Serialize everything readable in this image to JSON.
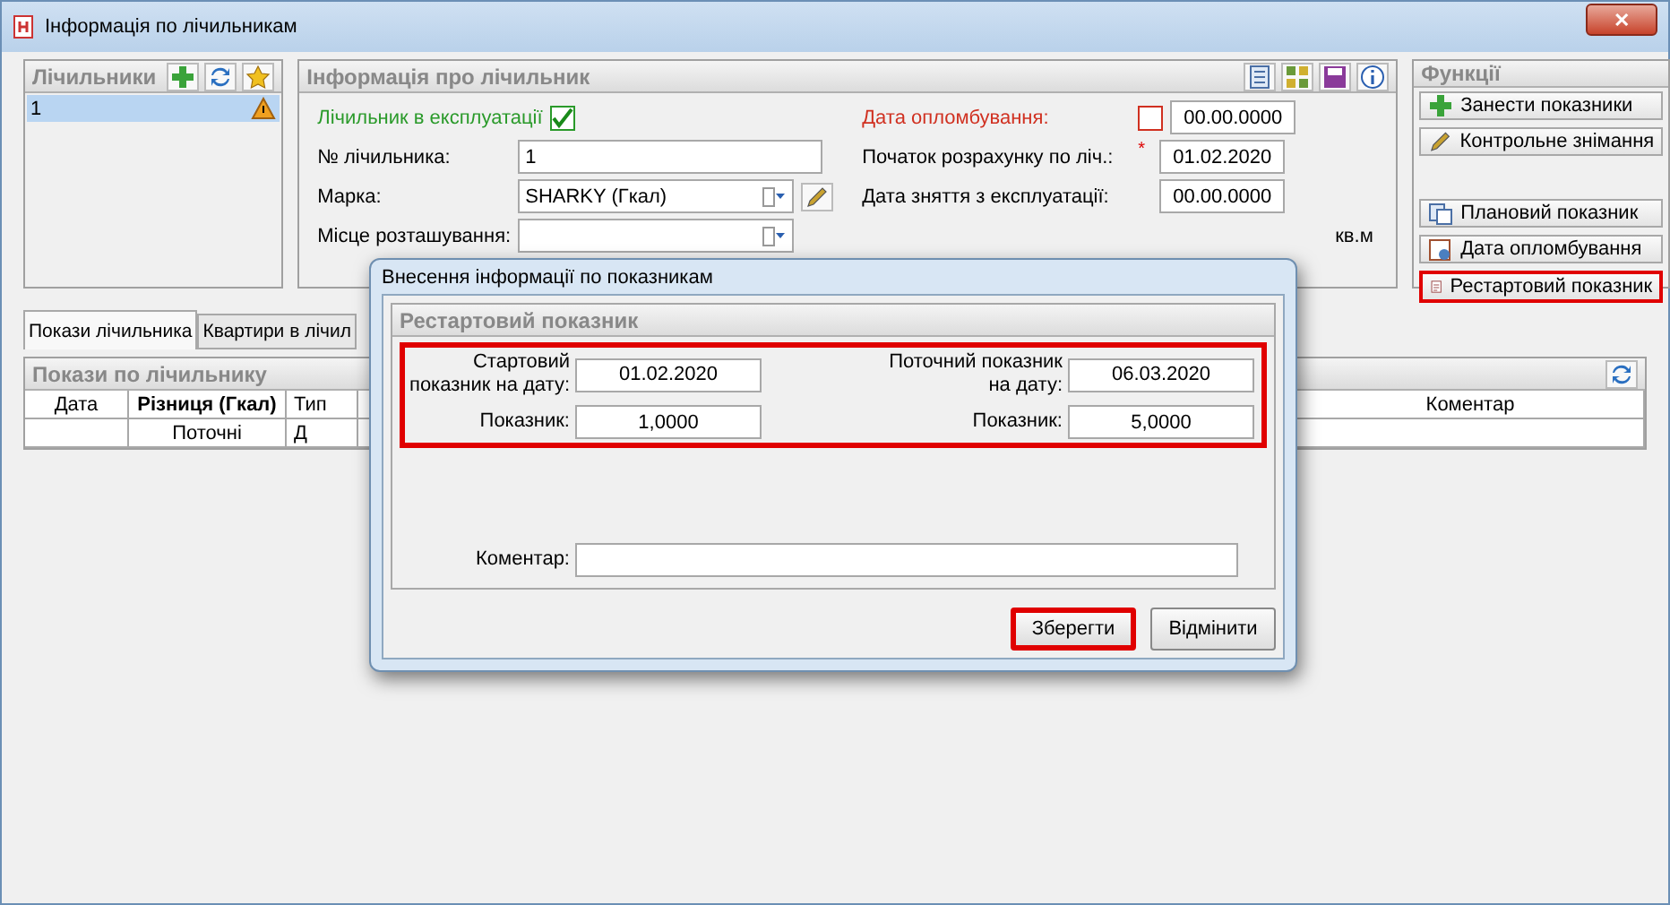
{
  "window": {
    "title": "Інформація по лічильникам",
    "close": "✕"
  },
  "meters": {
    "title": "Лічильники",
    "rows": [
      {
        "number": "1",
        "warning": true,
        "selected": true
      }
    ]
  },
  "info": {
    "title": "Інформація про лічильник",
    "in_service": {
      "label": "Лічильник в експлуатації",
      "checked": true
    },
    "left_fields": [
      {
        "kind": "text",
        "label": "№ лічильника:",
        "value": "1"
      },
      {
        "kind": "select",
        "label": "Марка:",
        "value": "SHARKY (Гкал)",
        "editable": true
      },
      {
        "kind": "select",
        "label": "Місце розташування:",
        "editable": false
      }
    ],
    "right_fields": [
      {
        "label": "Дата опломбування:",
        "value": "00.00.0000",
        "warn": true,
        "checkbox": {
          "checked": false
        }
      },
      {
        "label": "Початок розрахунку по ліч.:",
        "value": "01.02.2020",
        "warn": false,
        "required": "*"
      },
      {
        "label": "Дата зняття з експлуатації:",
        "value": "00.00.0000",
        "warn": false
      }
    ],
    "area_unit": "кв.м"
  },
  "functions": {
    "title": "Функції",
    "buttons": [
      {
        "label": "Занести показники",
        "highlighted": false
      },
      {
        "label": "Контрольне знімання",
        "highlighted": false
      },
      {
        "label": "Плановий показник",
        "highlighted": false
      },
      {
        "label": "Дата опломбування",
        "highlighted": false
      },
      {
        "label": "Рестартовий показник",
        "highlighted": true
      }
    ]
  },
  "tabs": [
    {
      "label": "Покази лічильника",
      "selected": true
    },
    {
      "label": "Квартири в лічил",
      "selected": false
    }
  ],
  "readings": {
    "title": "Покази по лічильнику",
    "columns": [
      {
        "label": "Дата",
        "bold": false
      },
      {
        "label": "Різниця (Гкал)",
        "bold": true,
        "sub": "Поточні"
      },
      {
        "label": "Тип",
        "bold": false,
        "sub": "Д"
      },
      {
        "label": "Коментар",
        "bold": false
      }
    ]
  },
  "dialog": {
    "title": "Внесення інформації по показникам",
    "group": "Рестартовий показник",
    "highlighted": true,
    "start": {
      "date_label": "Стартовий показник на дату:",
      "date": "01.02.2020",
      "value_label": "Показник:",
      "value": "1,0000"
    },
    "current": {
      "date_label": "Поточний показник на дату:",
      "date": "06.03.2020",
      "value_label": "Показник:",
      "value": "5,0000"
    },
    "comment_label": "Коментар:",
    "buttons": [
      {
        "label": "Зберегти",
        "highlighted": true
      },
      {
        "label": "Відмінити",
        "highlighted": false
      }
    ]
  }
}
